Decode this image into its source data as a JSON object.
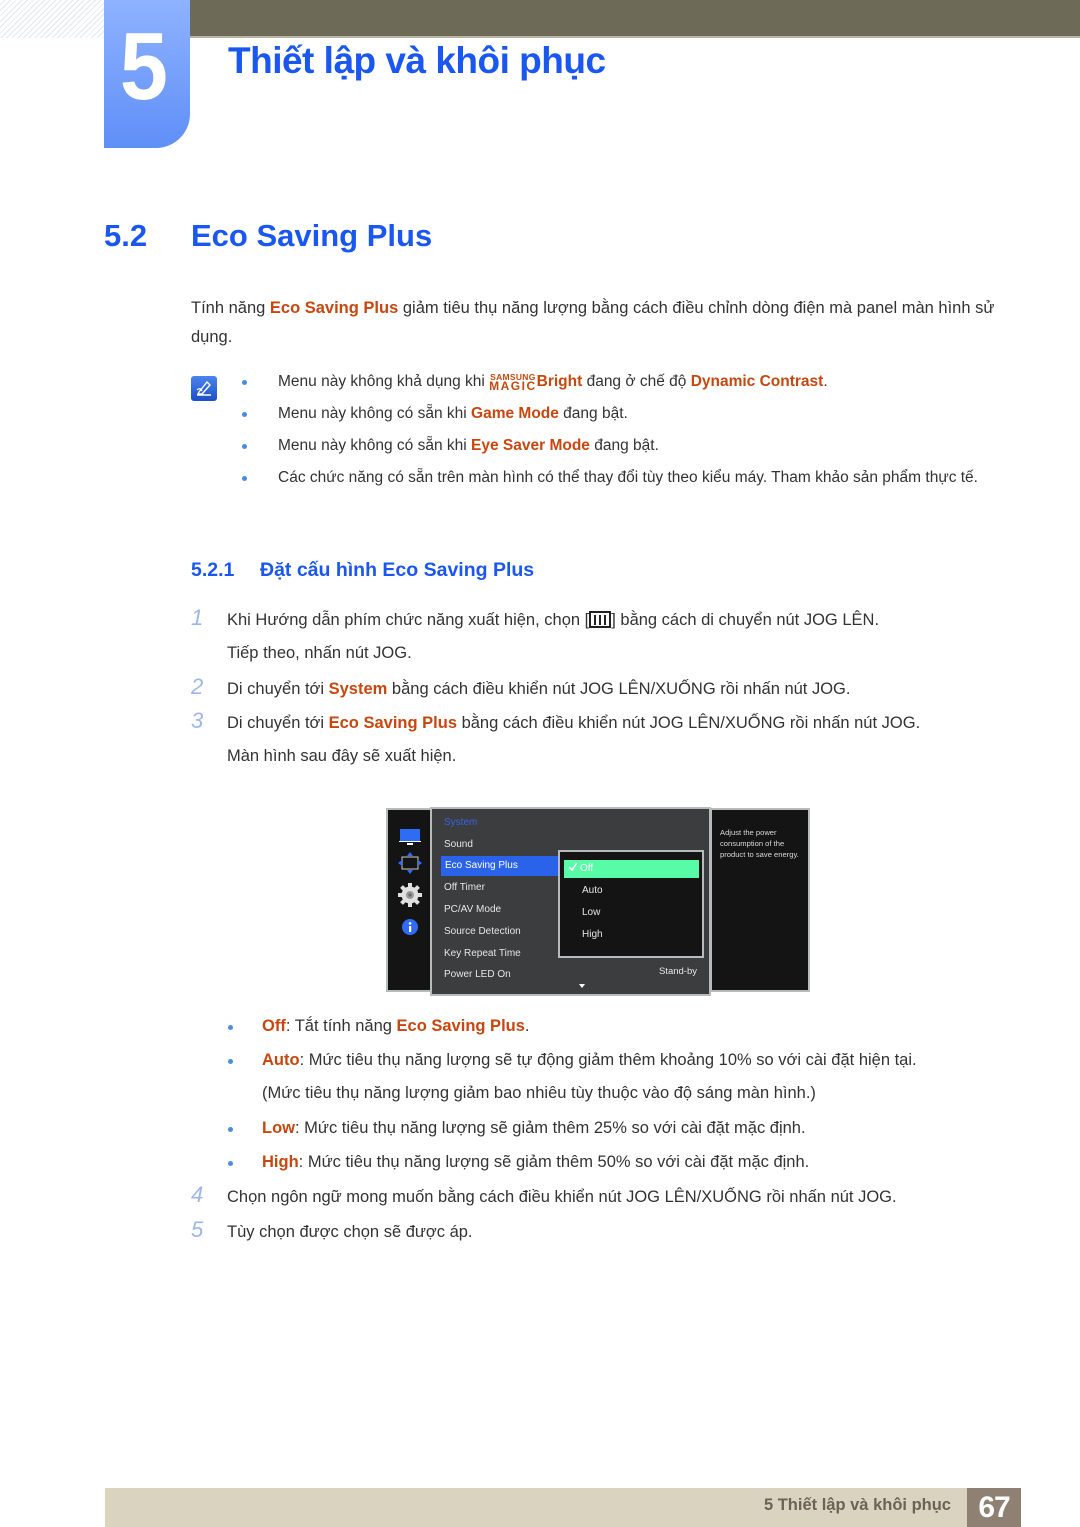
{
  "header": {
    "chapter_number": "5",
    "chapter_title": "Thiết lập và khôi phục"
  },
  "section": {
    "number": "5.2",
    "title": "Eco Saving Plus",
    "intro": {
      "pre": "Tính năng ",
      "highlight": "Eco Saving Plus",
      "post": " giảm tiêu thụ năng lượng bằng cách điều chỉnh dòng điện mà panel màn hình sử dụng."
    }
  },
  "notes": {
    "icon": "note-pencil-icon",
    "items": [
      {
        "pre": "Menu này không khả dụng khi ",
        "magic_top": "SAMSUNG",
        "magic_bottom": "MAGIC",
        "brand": "Bright",
        "mid": " đang ở chế độ ",
        "highlight": "Dynamic Contrast",
        "post": "."
      },
      {
        "pre": "Menu này không có sẵn khi ",
        "highlight": "Game Mode",
        "post": " đang bật."
      },
      {
        "pre": "Menu này không có sẵn khi ",
        "highlight": "Eye Saver Mode",
        "post": " đang bật."
      },
      {
        "text": "Các chức năng có sẵn trên màn hình có thể thay đổi tùy theo kiểu máy. Tham khảo sản phẩm thực tế."
      }
    ]
  },
  "subsection": {
    "number": "5.2.1",
    "title": "Đặt cấu hình Eco Saving Plus"
  },
  "steps": [
    {
      "num": "1",
      "pre": "Khi Hướng dẫn phím chức năng xuất hiện, chọn [",
      "icon": "menu-grid-icon",
      "post": "] bằng cách di chuyển nút JOG LÊN.",
      "line2": "Tiếp theo, nhấn nút JOG."
    },
    {
      "num": "2",
      "pre": "Di chuyển tới ",
      "highlight": "System",
      "post": " bằng cách điều khiển nút JOG LÊN/XUỐNG rồi nhấn nút JOG."
    },
    {
      "num": "3",
      "pre": "Di chuyển tới ",
      "highlight": "Eco Saving Plus",
      "post": " bằng cách điều khiển nút JOG LÊN/XUỐNG rồi nhấn nút JOG.",
      "line2": "Màn hình sau đây sẽ xuất hiện."
    },
    {
      "num": "4",
      "text": "Chọn ngôn ngữ mong muốn bằng cách điều khiển nút JOG LÊN/XUỐNG rồi nhấn nút JOG."
    },
    {
      "num": "5",
      "text": "Tùy chọn được chọn sẽ được áp."
    }
  ],
  "osd": {
    "side_icons": [
      "monitor-icon",
      "resize-arrows-icon",
      "gear-icon",
      "info-icon"
    ],
    "menu_title": "System",
    "menu_items": [
      "Sound",
      "Eco Saving Plus",
      "Off Timer",
      "PC/AV Mode",
      "Source Detection",
      "Key Repeat Time",
      "Power LED On"
    ],
    "selected_item": "Eco Saving Plus",
    "power_led_value": "Stand-by",
    "options": [
      "Off",
      "Auto",
      "Low",
      "High"
    ],
    "selected_option": "Off",
    "help_text": "Adjust the power consumption of the product to save energy.",
    "colors": {
      "menu_selected": "#2a62ea",
      "option_selected": "#58fba6",
      "title": "#3b62e4"
    }
  },
  "option_descriptions": [
    {
      "label": "Off",
      "pre": ": Tắt tính năng ",
      "highlight": "Eco Saving Plus",
      "post": "."
    },
    {
      "label": "Auto",
      "text": ": Mức tiêu thụ năng lượng sẽ tự động giảm thêm khoảng 10% so với cài đặt hiện tại.",
      "line2": "(Mức tiêu thụ năng lượng giảm bao nhiêu tùy thuộc vào độ sáng màn hình.)"
    },
    {
      "label": "Low",
      "text": ": Mức tiêu thụ năng lượng sẽ giảm thêm 25% so với cài đặt mặc định."
    },
    {
      "label": "High",
      "text": ": Mức tiêu thụ năng lượng sẽ giảm thêm 50% so với cài đặt mặc định."
    }
  ],
  "footer": {
    "chapter_label": "5 Thiết lập và khôi phục",
    "page_number": "67"
  },
  "colors": {
    "heading_blue": "#1a56f0",
    "highlight_orange": "#c7470e",
    "top_band": "#6d6b57",
    "footer_band": "#d9d3c0",
    "page_badge": "#8e8072"
  }
}
